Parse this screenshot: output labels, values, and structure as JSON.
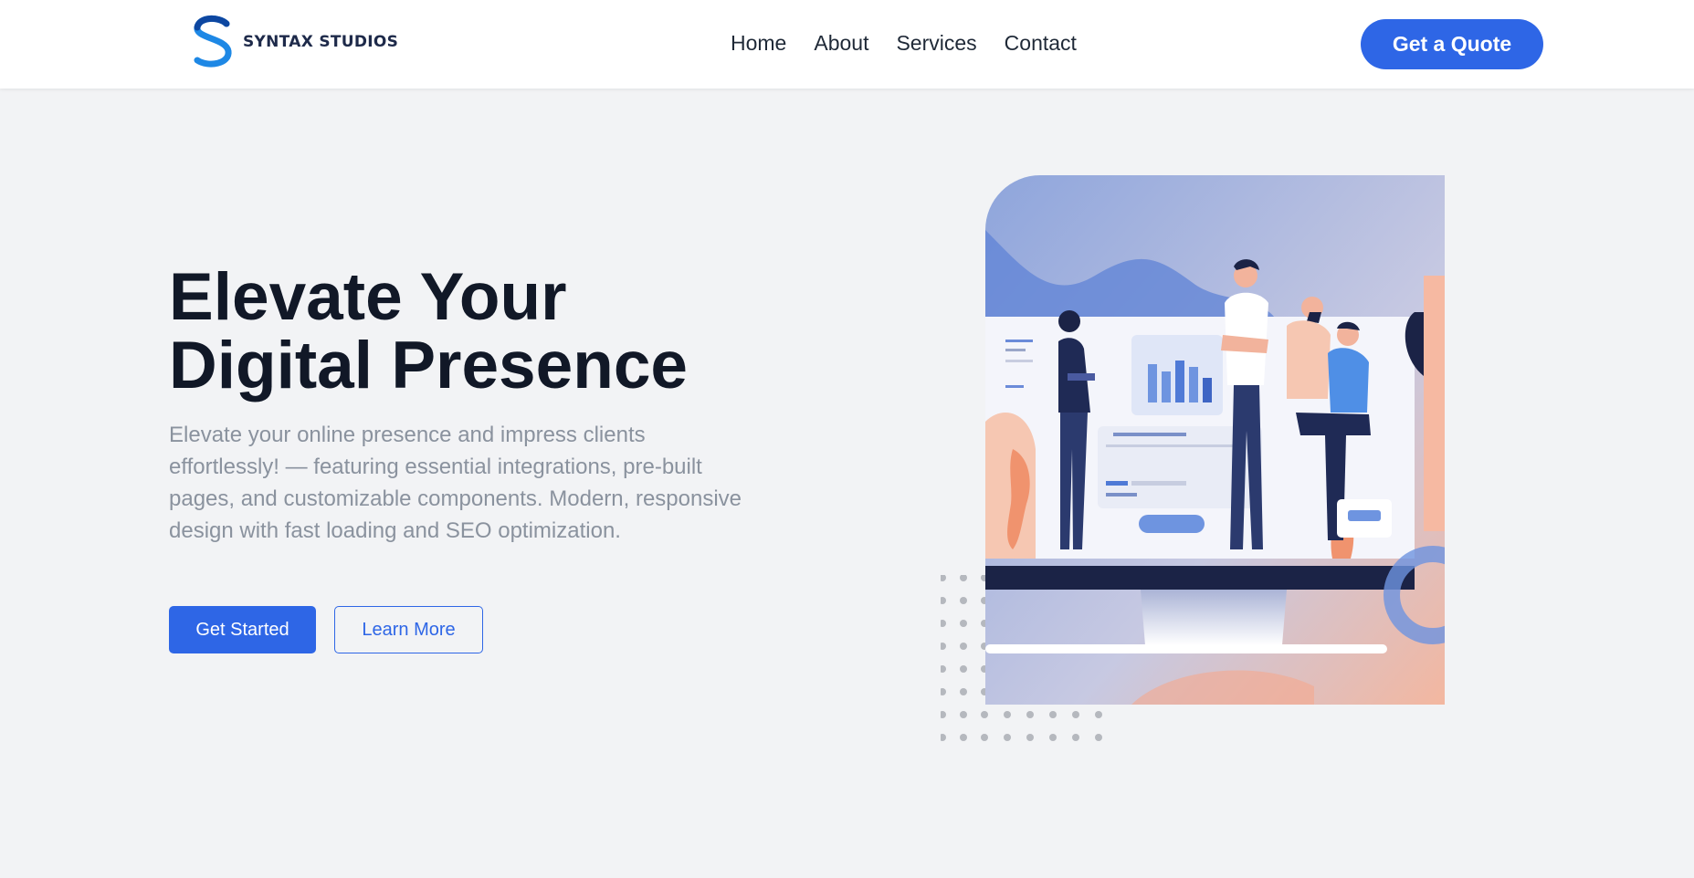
{
  "brand": {
    "name": "SYNTAX STUDIOS",
    "logo_icon": "s-logo-icon",
    "accent": "#2e66e6"
  },
  "nav": {
    "items": [
      "Home",
      "About",
      "Services",
      "Contact"
    ],
    "cta": "Get a Quote"
  },
  "hero": {
    "title_line1": "Elevate Your",
    "title_line2": "Digital Presence",
    "description": "Elevate your online presence and impress clients effortlessly! — featuring essential integrations, pre-built pages, and customizable components. Modern, responsive design with fast loading and SEO optimization.",
    "primary_button": "Get Started",
    "secondary_button": "Learn More"
  },
  "colors": {
    "page_bg": "#f2f3f5",
    "nav_bg": "#ffffff",
    "primary": "#2e66e6",
    "heading": "#111827",
    "muted": "#8a929e"
  }
}
